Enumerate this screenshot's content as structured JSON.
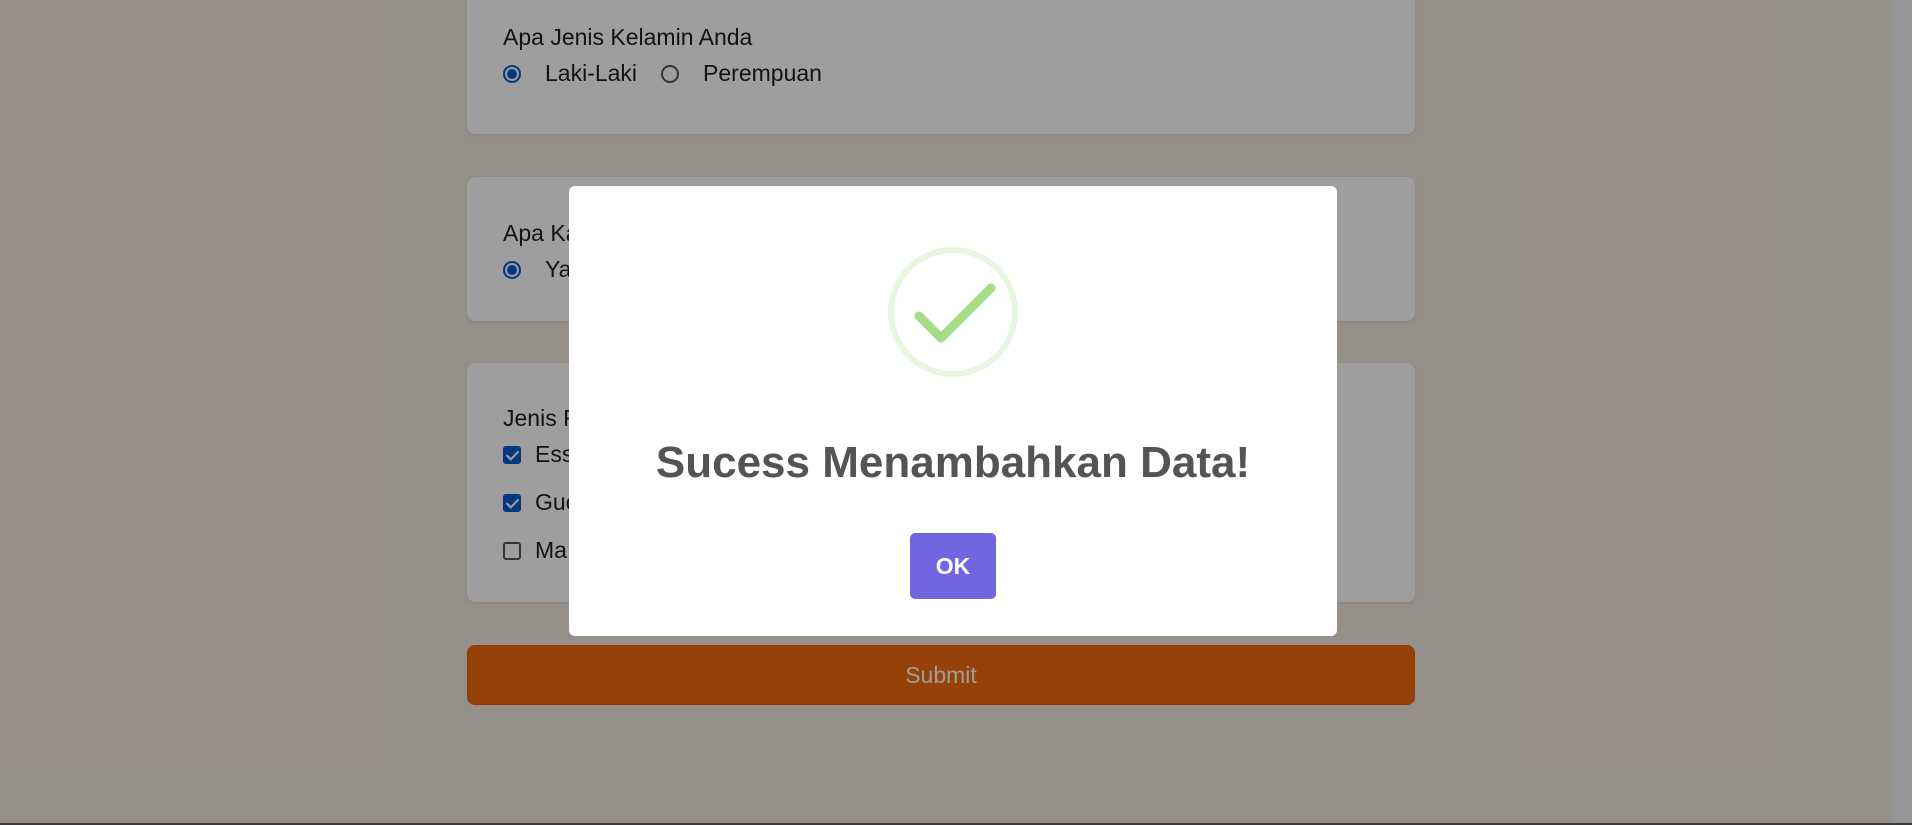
{
  "form": {
    "gender": {
      "question": "Apa Jenis Kelamin Anda",
      "options": [
        {
          "label": "Laki-Laki",
          "selected": true
        },
        {
          "label": "Perempuan",
          "selected": false
        }
      ]
    },
    "second": {
      "question": "Apa Ka",
      "options": [
        {
          "label": "Ya",
          "selected": true
        }
      ]
    },
    "third": {
      "question": "Jenis F",
      "options": [
        {
          "label": "Ess",
          "checked": true
        },
        {
          "label": "Guc",
          "checked": true
        },
        {
          "label": "Ma",
          "checked": false
        }
      ]
    },
    "submit_label": "Submit"
  },
  "dialog": {
    "icon": "success-checkmark-icon",
    "title": "Sucess Menambahkan Data!",
    "ok_label": "OK"
  },
  "colors": {
    "accent": "#7066e0",
    "submit": "#f26a0c",
    "success": "#a5dc86",
    "radio_checked": "#0b57d0"
  }
}
